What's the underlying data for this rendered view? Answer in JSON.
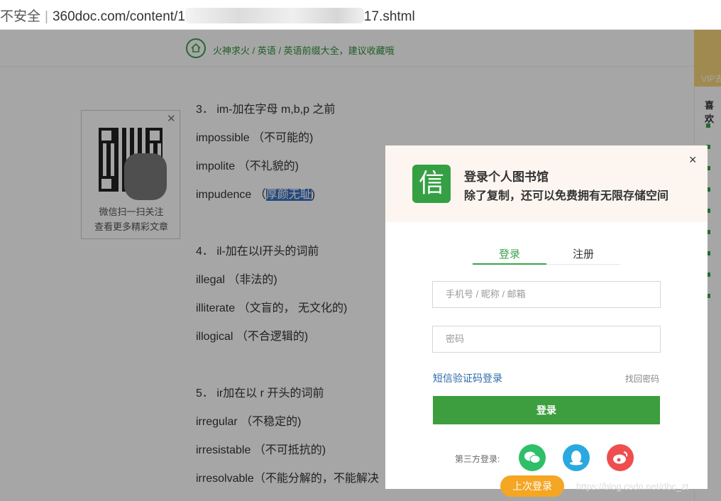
{
  "browser": {
    "insecure_label": "不安全",
    "url_prefix": "360doc.com/content/1",
    "url_suffix": "17.shtml"
  },
  "breadcrumb": {
    "text": "火神求火 / 英语 / 英语前缀大全，建议收藏哦"
  },
  "right_ad": {
    "vip": "VIP去"
  },
  "right_side": {
    "title": "喜欢"
  },
  "qr_box": {
    "line1": "微信扫一扫关注",
    "line2": "查看更多精彩文章"
  },
  "article": {
    "lines": [
      "3． im-加在字母 m,b,p 之前",
      "impossible （不可能的)",
      "impolite （不礼貌的)",
      "impudence （",
      "",
      "4． il-加在以l开头的词前",
      "illegal （非法的)",
      "illiterate （文盲的， 无文化的)",
      "illogical （不合逻辑的)",
      "",
      "5． ir加在以 r 开头的词前",
      "irregular （不稳定的)",
      "irresistable （不可抵抗的)",
      "irresolvable（不能分解的，不能解决"
    ],
    "highlight": "厚颜无耻",
    "highlight_tail": ")"
  },
  "modal": {
    "logo_char": "信",
    "title": "登录个人图书馆",
    "subtitle": "除了复制，还可以免费拥有无限存储空间",
    "close": "×",
    "tab_login": "登录",
    "tab_register": "注册",
    "username_placeholder": "手机号 / 昵称 / 邮箱",
    "password_placeholder": "密码",
    "sms_login": "短信验证码登录",
    "forgot": "找回密码",
    "login_button": "登录",
    "third_party": "第三方登录:",
    "last_login": "上次登录"
  },
  "watermark": "https://blog.csdn.net/dbc_zt"
}
